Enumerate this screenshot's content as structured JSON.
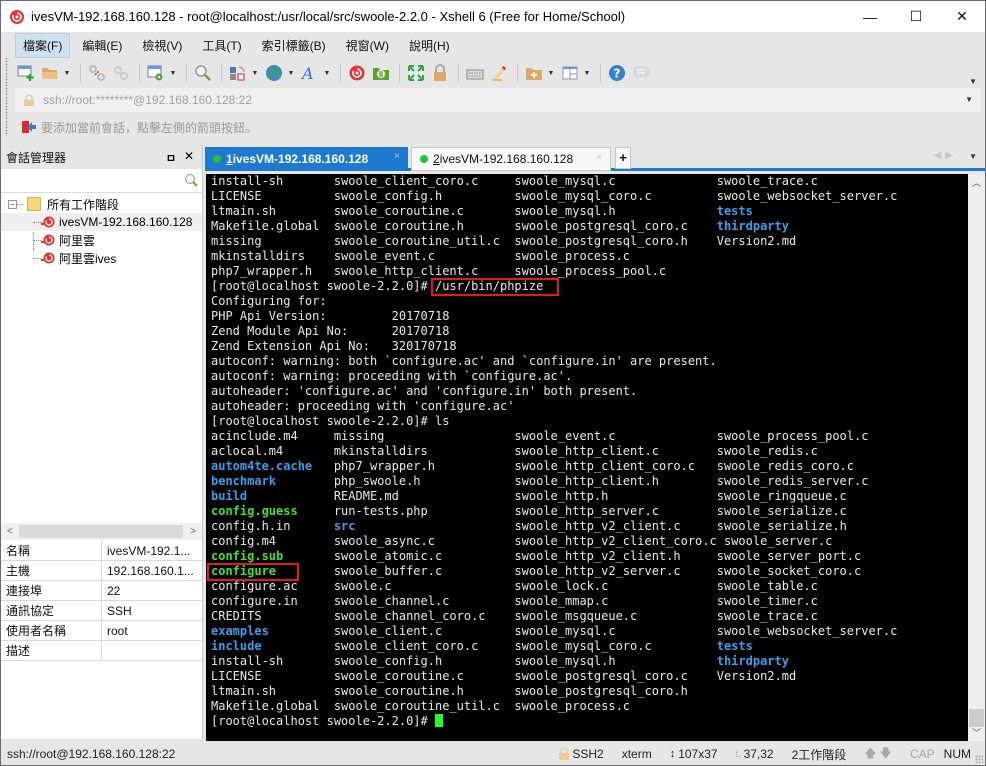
{
  "window": {
    "title": "ivesVM-192.168.160.128 - root@localhost:/usr/local/src/swoole-2.2.0 - Xshell 6 (Free for Home/School)",
    "controls": {
      "minimize": "—",
      "maximize": "☐",
      "close": "✕"
    }
  },
  "menu": {
    "items": [
      "檔案(F)",
      "編輯(E)",
      "檢視(V)",
      "工具(T)",
      "索引標籤(B)",
      "視窗(W)",
      "說明(H)"
    ],
    "active_index": 0
  },
  "toolbar": {
    "icons": [
      "new-session-icon",
      "open-folder-icon",
      "disconnect-icon",
      "reconnect-icon",
      "properties-icon",
      "find-icon",
      "transfer-icon",
      "globe-icon",
      "font-icon",
      "xshell-icon",
      "xftp-icon",
      "fullscreen-icon",
      "lock-icon",
      "keyboard-icon",
      "highlight-icon",
      "new-folder-icon",
      "layout-icon",
      "help-icon",
      "chat-icon"
    ]
  },
  "address": {
    "value": "ssh://root:********@192.168.160.128:22"
  },
  "hint": {
    "text": "要添加當前會話，點擊左側的箭頭按鈕。"
  },
  "sidebar": {
    "title": "會話管理器",
    "pin": "ㅁ",
    "close": "✕",
    "tree": {
      "root": "所有工作階段",
      "expander": "−",
      "sessions": [
        "ivesVM-192.168.160.128",
        "阿里雲",
        "阿里雲ives"
      ],
      "selected_index": 0
    },
    "scroll": {
      "left": "<",
      "right": ">"
    },
    "properties": [
      {
        "key": "名稱",
        "value": "ivesVM-192.1..."
      },
      {
        "key": "主機",
        "value": "192.168.160.1..."
      },
      {
        "key": "連接埠",
        "value": "22"
      },
      {
        "key": "通訊協定",
        "value": "SSH"
      },
      {
        "key": "使用者名稱",
        "value": "root"
      },
      {
        "key": "描述",
        "value": ""
      }
    ]
  },
  "tabs": {
    "items": [
      {
        "number": "1",
        "label": " ivesVM-192.168.160.128",
        "close": "×",
        "status_color": "#22c33a"
      },
      {
        "number": "2",
        "label": " ivesVM-192.168.160.128",
        "close": "×",
        "status_color": "#22c33a"
      }
    ],
    "add": "+",
    "nav": "◀▶",
    "list": "▼",
    "accent": "#1e7ad0"
  },
  "terminal": {
    "lines": [
      [
        {
          "t": "install-sh       swoole_client_coro.c     swoole_mysql.c              swoole_trace.c"
        }
      ],
      [
        {
          "t": "LICENSE          swoole_config.h          swoole_mysql_coro.c         swoole_websocket_server.c"
        }
      ],
      [
        {
          "t": "ltmain.sh        swoole_coroutine.c       swoole_mysql.h              "
        },
        {
          "t": "tests",
          "c": "blue"
        }
      ],
      [
        {
          "t": "Makefile.global  swoole_coroutine.h       swoole_postgresql_coro.c    "
        },
        {
          "t": "thirdparty",
          "c": "blue"
        }
      ],
      [
        {
          "t": "missing          swoole_coroutine_util.c  swoole_postgresql_coro.h    Version2.md"
        }
      ],
      [
        {
          "t": "mkinstalldirs    swoole_event.c           swoole_process.c"
        }
      ],
      [
        {
          "t": "php7_wrapper.h   swoole_http_client.c     swoole_process_pool.c"
        }
      ],
      [
        {
          "t": "[root@localhost swoole-2.2.0]# /usr/bin/phpize"
        }
      ],
      [
        {
          "t": "Configuring for:"
        }
      ],
      [
        {
          "t": "PHP Api Version:         20170718"
        }
      ],
      [
        {
          "t": "Zend Module Api No:      20170718"
        }
      ],
      [
        {
          "t": "Zend Extension Api No:   320170718"
        }
      ],
      [
        {
          "t": "autoconf: warning: both `configure.ac' and `configure.in' are present."
        }
      ],
      [
        {
          "t": "autoconf: warning: proceeding with `configure.ac'."
        }
      ],
      [
        {
          "t": "autoheader: 'configure.ac' and 'configure.in' both present."
        }
      ],
      [
        {
          "t": "autoheader: proceeding with 'configure.ac'"
        }
      ],
      [
        {
          "t": "[root@localhost swoole-2.2.0]# ls"
        }
      ],
      [
        {
          "t": "acinclude.m4     missing                  swoole_event.c              swoole_process_pool.c"
        }
      ],
      [
        {
          "t": "aclocal.m4       mkinstalldirs            swoole_http_client.c        swoole_redis.c"
        }
      ],
      [
        {
          "t": "autom4te.cache",
          "c": "blue"
        },
        {
          "t": "   php7_wrapper.h           swoole_http_client_coro.c   swoole_redis_coro.c"
        }
      ],
      [
        {
          "t": "benchmark",
          "c": "blue"
        },
        {
          "t": "        php_swoole.h             swoole_http_client.h        swoole_redis_server.c"
        }
      ],
      [
        {
          "t": "build",
          "c": "blue"
        },
        {
          "t": "            README.md                swoole_http.h               swoole_ringqueue.c"
        }
      ],
      [
        {
          "t": "config.guess",
          "c": "green"
        },
        {
          "t": "     run-tests.php            swoole_http_server.c        swoole_serialize.c"
        }
      ],
      [
        {
          "t": "config.h.in      "
        },
        {
          "t": "src",
          "c": "blue"
        },
        {
          "t": "                      swoole_http_v2_client.c     swoole_serialize.h"
        }
      ],
      [
        {
          "t": "config.m4        swoole_async.c           swoole_http_v2_client_coro.c swoole_server.c"
        }
      ],
      [
        {
          "t": "config.sub",
          "c": "green"
        },
        {
          "t": "       swoole_atomic.c          swoole_http_v2_client.h     swoole_server_port.c"
        }
      ],
      [
        {
          "t": "configure",
          "c": "green"
        },
        {
          "t": "        swoole_buffer.c          swoole_http_v2_server.c     swoole_socket_coro.c"
        }
      ],
      [
        {
          "t": "configure.ac     swoole.c                 swoole_lock.c               swoole_table.c"
        }
      ],
      [
        {
          "t": "configure.in     swoole_channel.c         swoole_mmap.c               swoole_timer.c"
        }
      ],
      [
        {
          "t": "CREDITS          swoole_channel_coro.c    swoole_msgqueue.c           swoole_trace.c"
        }
      ],
      [
        {
          "t": "examples",
          "c": "blue"
        },
        {
          "t": "         swoole_client.c          swoole_mysql.c              swoole_websocket_server.c"
        }
      ],
      [
        {
          "t": "include",
          "c": "blue"
        },
        {
          "t": "          swoole_client_coro.c     swoole_mysql_coro.c         "
        },
        {
          "t": "tests",
          "c": "blue"
        }
      ],
      [
        {
          "t": "install-sh       swoole_config.h          swoole_mysql.h              "
        },
        {
          "t": "thirdparty",
          "c": "blue"
        }
      ],
      [
        {
          "t": "LICENSE          swoole_coroutine.c       swoole_postgresql_coro.c    Version2.md"
        }
      ],
      [
        {
          "t": "ltmain.sh        swoole_coroutine.h       swoole_postgresql_coro.h"
        }
      ],
      [
        {
          "t": "Makefile.global  swoole_coroutine_util.c  swoole_process.c"
        }
      ],
      [
        {
          "t": "[root@localhost swoole-2.2.0]# "
        },
        {
          "cursor": true
        }
      ]
    ],
    "highlights": [
      "/usr/bin/phpize",
      "configure"
    ]
  },
  "statusbar": {
    "left": "ssh://root@192.168.160.128:22",
    "protocol": "SSH2",
    "term_type": "xterm",
    "size": "107x37",
    "cursor_pos": "37,32",
    "sessions": "2工作階段",
    "up": "🡅",
    "down": "🡇",
    "cap": "CAP",
    "num": "NUM"
  }
}
